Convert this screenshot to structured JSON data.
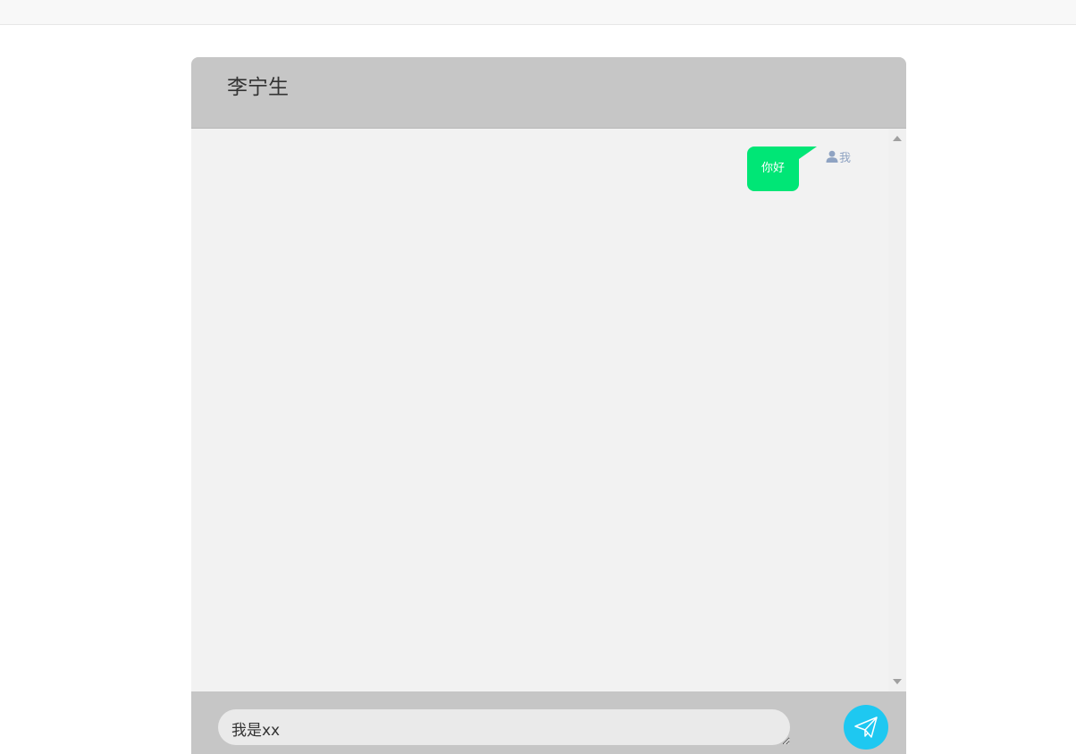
{
  "header": {
    "contact_name": "李宁生"
  },
  "messages": [
    {
      "text": "你好",
      "sender": "我",
      "side": "right",
      "bubble_color": "#00e676"
    }
  ],
  "composer": {
    "value": "我是xx"
  },
  "colors": {
    "header_bg": "#c6c6c6",
    "message_area_bg": "#f2f2f2",
    "send_button": "#1ec8f1",
    "sender_label": "#8fa3c2"
  },
  "icons": {
    "sender": "user-icon",
    "send": "paper-plane-icon"
  }
}
